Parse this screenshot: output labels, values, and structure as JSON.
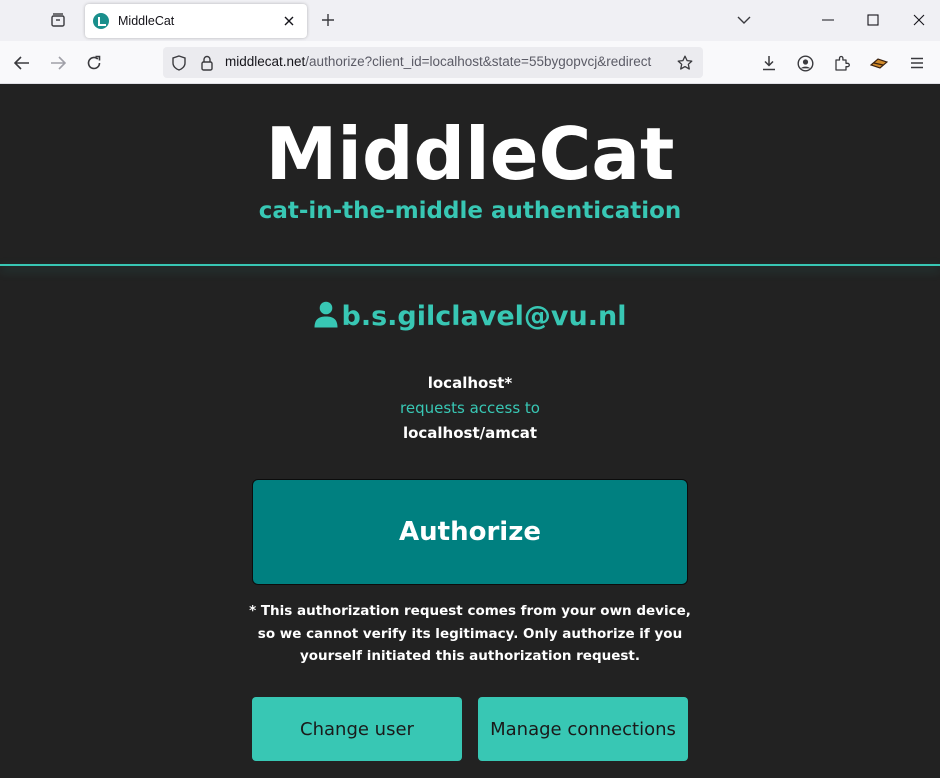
{
  "browser": {
    "tab": {
      "title": "MiddleCat"
    },
    "url": {
      "host": "middlecat.net",
      "path": "/authorize?client_id=localhost&state=55bygopvcj&redirect"
    },
    "icons": [
      "tab-list-icon",
      "favicon-icon",
      "close-tab-icon",
      "new-tab-icon",
      "tab-overflow-icon",
      "minimize-icon",
      "maximize-icon",
      "close-window-icon",
      "back-icon",
      "forward-icon",
      "reload-icon",
      "tracking-protection-icon",
      "lock-icon",
      "bookmark-star-icon",
      "downloads-icon",
      "account-icon",
      "extensions-icon",
      "extension-icon",
      "menu-icon"
    ]
  },
  "header": {
    "title": "MiddleCat",
    "tagline": "cat-in-the-middle authentication"
  },
  "user": {
    "email": "b.s.gilclavel@vu.nl"
  },
  "request": {
    "client": "localhost*",
    "verb": "requests access to",
    "resource": "localhost/amcat"
  },
  "buttons": {
    "authorize": "Authorize",
    "change_user": "Change user",
    "manage_connections": "Manage connections"
  },
  "note": "* This authorization request comes from your own device, so we cannot verify its legitimacy. Only authorize if you yourself initiated this authorization request.",
  "colors": {
    "accent": "#38c7b4",
    "authorize_bg": "#008080",
    "page_bg": "#222222"
  }
}
